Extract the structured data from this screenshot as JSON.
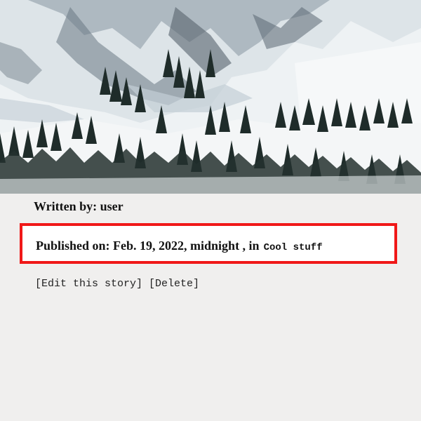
{
  "story": {
    "hero_image": {
      "alt": "snowy mountain slope with evergreen trees",
      "colors": {
        "sky": "#e8eef1",
        "snow": "#f4f6f7",
        "shadow": "#b9c6cf",
        "rock": "#4e5b66",
        "tree": "#1f2c2a"
      }
    },
    "author_line": "Written by: user",
    "published_prefix": "Published on: Feb. 19, 2022, midnight , in",
    "category": "Cool stuff",
    "actions": {
      "edit_label": "[Edit this story]",
      "delete_label": "[Delete]"
    },
    "highlight_color": "#f01818"
  }
}
